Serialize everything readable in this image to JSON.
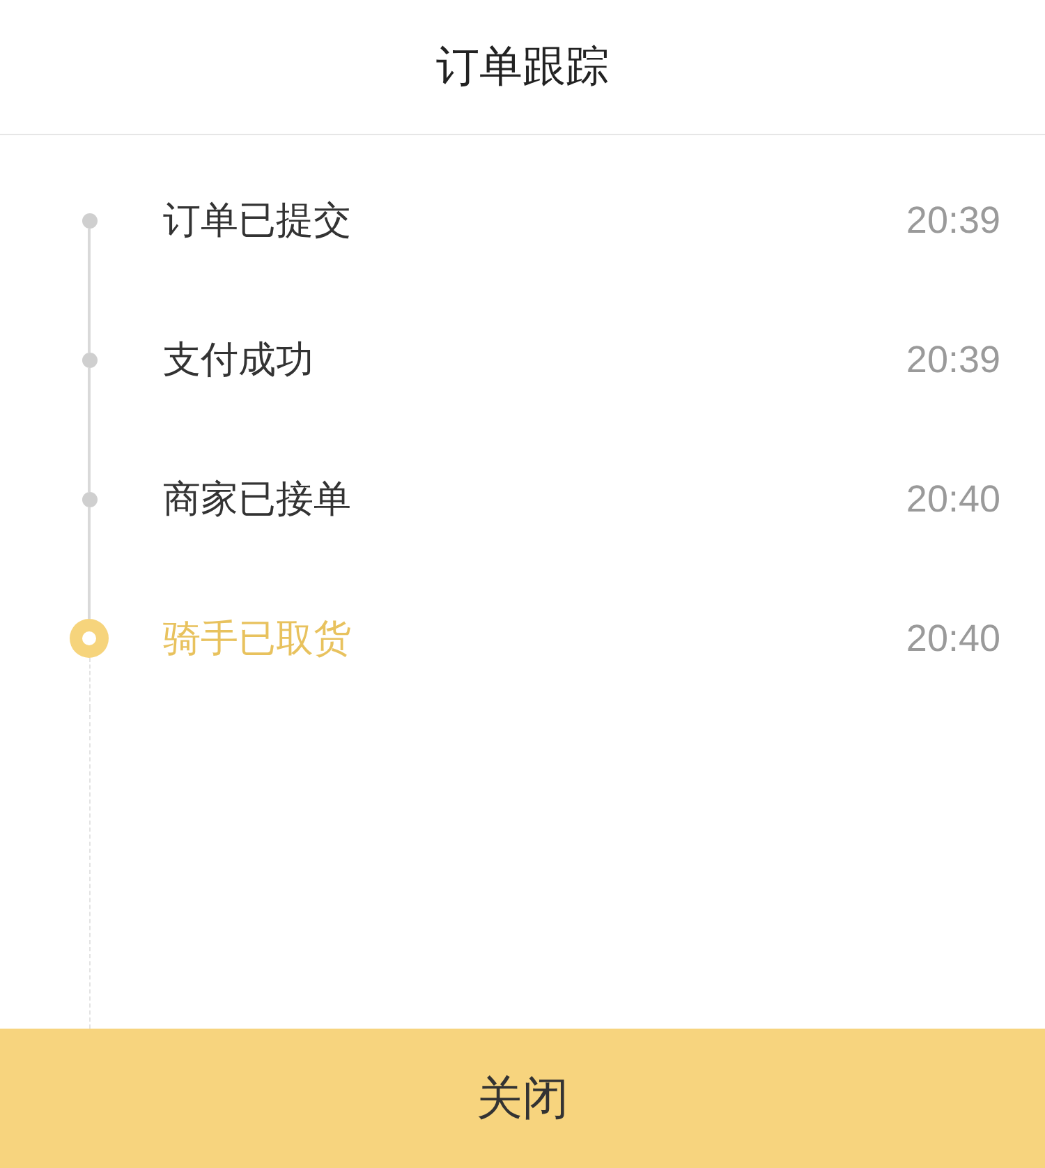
{
  "title": "订单跟踪",
  "events": [
    {
      "label": "订单已提交",
      "time": "20:39",
      "current": false
    },
    {
      "label": "支付成功",
      "time": "20:39",
      "current": false
    },
    {
      "label": "商家已接单",
      "time": "20:40",
      "current": false
    },
    {
      "label": "骑手已取货",
      "time": "20:40",
      "current": true
    }
  ],
  "close_button": "关闭"
}
